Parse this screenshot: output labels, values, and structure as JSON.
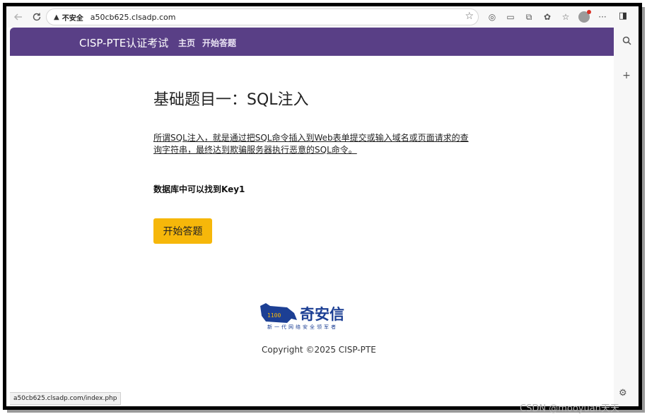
{
  "browser": {
    "insecure_label": "不安全",
    "url": "a50cb625.clsadp.com",
    "status_url": "a50cb625.clsadp.com/index.php"
  },
  "navbar": {
    "brand": "CISP-PTE认证考试",
    "links": [
      "主页",
      "开始答题"
    ]
  },
  "main": {
    "title": "基础题目一：SQL注入",
    "description": "所谓SQL注入，就是通过把SQL命令插入到Web表单提交或输入域名或页面请求的查询字符串，最终达到欺骗服务器执行恶意的SQL命令。",
    "hint": "数据库中可以找到Key1",
    "start_button": "开始答题"
  },
  "footer": {
    "logo_text": "奇安信",
    "logo_slogan": "新一代网络安全领军者",
    "copyright": "Copyright ©2025 CISP-PTE"
  },
  "watermark": "CSDN @mooyuan天天",
  "colors": {
    "navbar": "#593f86",
    "button": "#f6b70a",
    "logo": "#1c3f94"
  }
}
